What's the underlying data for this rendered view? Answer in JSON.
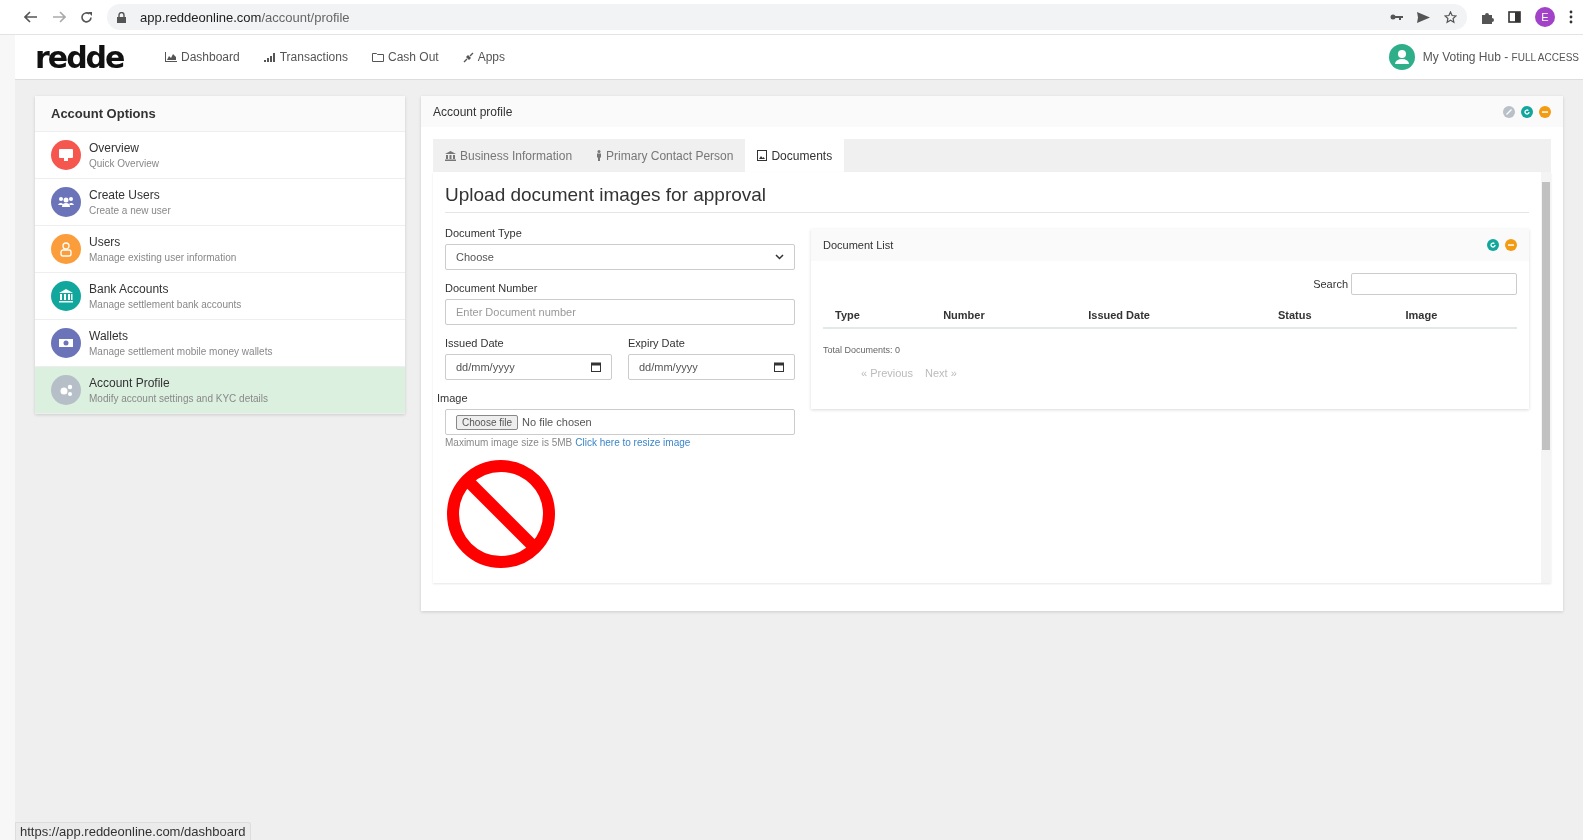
{
  "browser": {
    "url_host": "app.reddeonline.com",
    "url_path": "/account/profile",
    "profile_initial": "E"
  },
  "navbar": {
    "logo": "redde",
    "items": [
      {
        "label": "Dashboard"
      },
      {
        "label": "Transactions"
      },
      {
        "label": "Cash Out"
      },
      {
        "label": "Apps"
      }
    ],
    "account": {
      "name": "My Voting Hub - ",
      "access": "FULL ACCESS"
    }
  },
  "sidebar": {
    "title": "Account Options",
    "items": [
      {
        "title": "Overview",
        "subtitle": "Quick Overview",
        "color": "#f5574f",
        "selected": false
      },
      {
        "title": "Create Users",
        "subtitle": "Create a new user",
        "color": "#6b74b8",
        "selected": false
      },
      {
        "title": "Users",
        "subtitle": "Manage existing user information",
        "color": "#fb9d3a",
        "selected": false
      },
      {
        "title": "Bank Accounts",
        "subtitle": "Manage settlement bank accounts",
        "color": "#12a79d",
        "selected": false
      },
      {
        "title": "Wallets",
        "subtitle": "Manage settlement mobile money wallets",
        "color": "#6b74b8",
        "selected": false
      },
      {
        "title": "Account Profile",
        "subtitle": "Modify account settings and KYC details",
        "color": "#b6bec8",
        "selected": true
      }
    ]
  },
  "panel": {
    "title": "Account profile",
    "tabs": [
      {
        "label": "Business Information",
        "selected": false
      },
      {
        "label": "Primary Contact Person",
        "selected": false
      },
      {
        "label": "Documents",
        "selected": true
      }
    ],
    "heading": "Upload document images for approval",
    "form": {
      "document_type": {
        "label": "Document Type",
        "value": "Choose"
      },
      "document_number": {
        "label": "Document Number",
        "placeholder": "Enter Document number"
      },
      "issued_date": {
        "label": "Issued Date",
        "placeholder": "dd/mm/yyyy"
      },
      "expiry_date": {
        "label": "Expiry Date",
        "placeholder": "dd/mm/yyyy"
      },
      "image": {
        "label": "Image",
        "button": "Choose file",
        "status": "No file chosen",
        "hint": "Maximum image size is 5MB",
        "link": "Click here to resize image"
      }
    },
    "document_list": {
      "title": "Document List",
      "search_label": "Search",
      "columns": [
        "Type",
        "Number",
        "Issued Date",
        "Status",
        "Image"
      ],
      "total": "Total Documents: 0",
      "previous": "Previous",
      "next": "Next",
      "prev_mark": "«",
      "next_mark": "»"
    }
  },
  "status_bar": "https://app.reddeonline.com/dashboard"
}
